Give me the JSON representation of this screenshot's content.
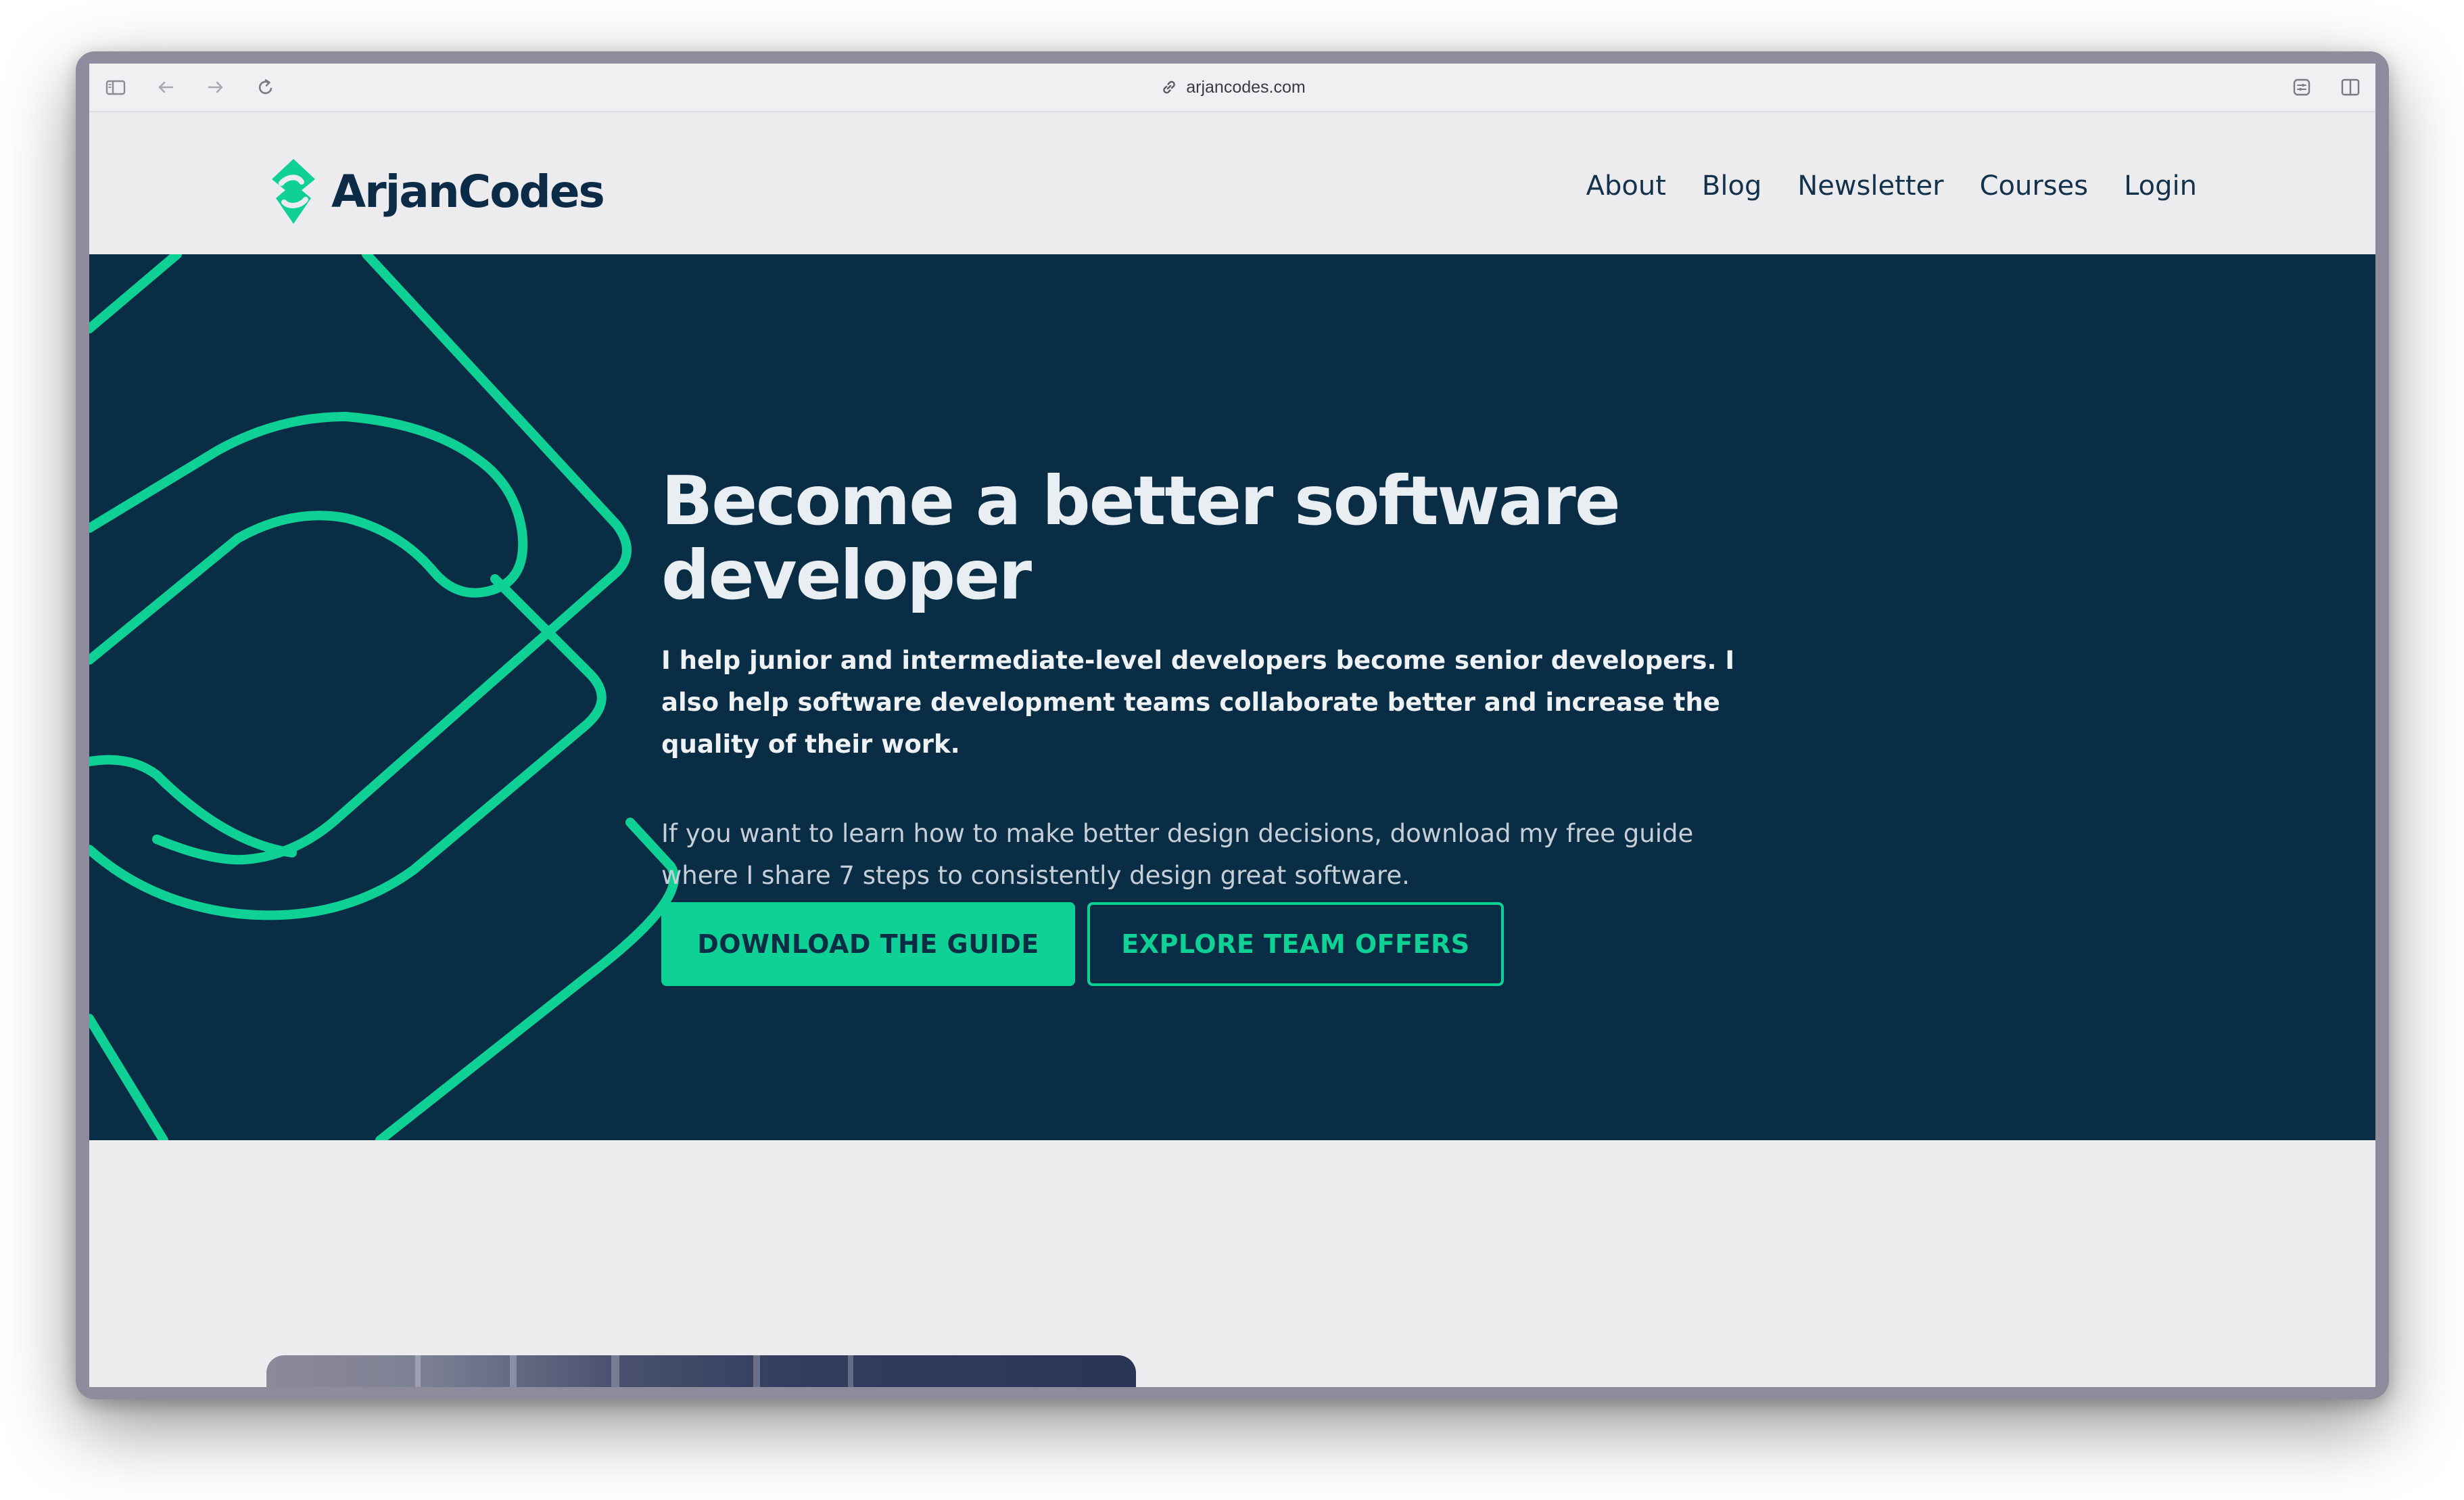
{
  "browser": {
    "url": "arjancodes.com",
    "icons": [
      "sidebar-icon",
      "back-icon",
      "forward-icon",
      "reload-icon",
      "link-icon",
      "extension-icon",
      "split-view-icon"
    ]
  },
  "header": {
    "logo_text": "ArjanCodes",
    "nav": [
      "About",
      "Blog",
      "Newsletter",
      "Courses",
      "Login"
    ]
  },
  "hero": {
    "title": "Become a better software developer",
    "lead": "I help junior and intermediate-level developers become senior developers. I also help software development teams collaborate better and increase the quality of their work.",
    "sub": "If you want to learn how to make better design decisions, download my free guide where I share 7 steps to consistently design great software.",
    "primary_button": "DOWNLOAD THE GUIDE",
    "secondary_button": "EXPLORE TEAM OFFERS"
  },
  "colors": {
    "brand_green": "#0fd195",
    "hero_bg": "#0a2d46",
    "logo_text": "#0b2b46",
    "page_bg": "#ececef"
  }
}
